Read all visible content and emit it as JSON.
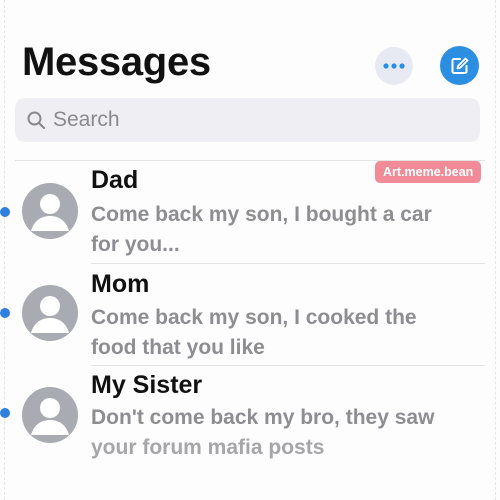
{
  "header": {
    "title": "Messages"
  },
  "search": {
    "placeholder": "Search"
  },
  "watermark": "Art.meme.bean",
  "conversations": [
    {
      "sender": "Dad",
      "preview_lines": [
        "Come back my son, I bought a car",
        "for you..."
      ],
      "unread": true
    },
    {
      "sender": "Mom",
      "preview_lines": [
        "Come back my son, I cooked the",
        "food that you like"
      ],
      "unread": true
    },
    {
      "sender": "My Sister",
      "preview_lines": [
        "Don't come back my bro, they saw",
        "your forum mafia posts"
      ],
      "unread": true
    }
  ],
  "icons": {
    "more": "ellipsis-icon",
    "compose": "compose-icon",
    "search": "search-icon",
    "avatar": "person-placeholder-icon"
  },
  "colors": {
    "accent": "#2b8ee0",
    "unread_dot": "#2f7fe0",
    "watermark_bg": "#f08b97"
  }
}
